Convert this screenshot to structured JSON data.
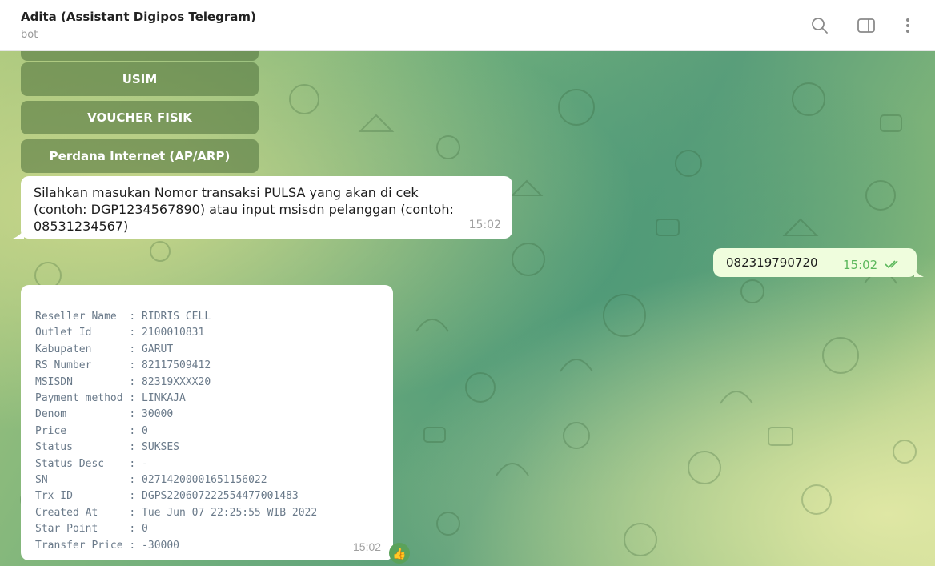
{
  "header": {
    "title": "Adita (Assistant Digipos Telegram)",
    "subtitle": "bot",
    "icons": [
      "search-icon",
      "sidebar-toggle-icon",
      "more-vertical-icon"
    ]
  },
  "keyboard": {
    "buttons": [
      "USIM",
      "VOUCHER FISIK",
      "Perdana Internet (AP/ARP)"
    ]
  },
  "messages": {
    "bot_prompt": {
      "line1": "Silahkan masukan Nomor transaksi PULSA yang akan di cek",
      "line2": "(contoh: DGP1234567890) atau input msisdn pelanggan (contoh:",
      "line3": "08531234567)",
      "time": "15:02"
    },
    "user_msg": {
      "text": "082319790720",
      "time": "15:02"
    },
    "result": {
      "time": "15:02",
      "reaction": "👍",
      "rows": [
        "Reseller Name  : RIDRIS CELL",
        "Outlet Id      : 2100010831",
        "Kabupaten      : GARUT",
        "RS Number      : 82117509412",
        "MSISDN         : 82319XXXX20",
        "Payment method : LINKAJA",
        "Denom          : 30000",
        "Price          : 0",
        "Status         : SUKSES",
        "Status Desc    : -",
        "SN             : 02714200001651156022",
        "Trx ID         : DGPS220607222554477001483",
        "Created At     : Tue Jun 07 22:25:55 WIB 2022",
        "Star Point     : 0",
        "Transfer Price : -30000"
      ]
    }
  },
  "colors": {
    "bubble_out": "#effddd",
    "read_check": "#5cb85c",
    "keyboard_button": "#4c703a"
  }
}
